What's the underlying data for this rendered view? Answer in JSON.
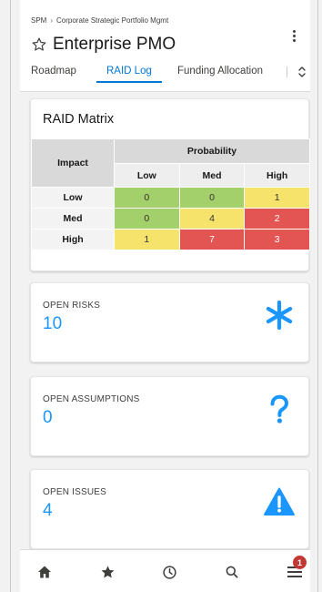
{
  "header": {
    "breadcrumb": [
      "SPM",
      "Corporate Strategic Portfolio Mgmt"
    ],
    "breadcrumb_separator": "›",
    "title": "Enterprise PMO",
    "favorite_icon": "star-outline-icon",
    "more_icon": "kebab-menu-icon"
  },
  "tabs": [
    {
      "label": "Roadmap",
      "active": false
    },
    {
      "label": "RAID Log",
      "active": true
    },
    {
      "label": "Funding Allocation",
      "active": false
    }
  ],
  "matrix": {
    "title": "RAID Matrix",
    "corner_header": "Impact",
    "group_header": "Probability",
    "columns": [
      "Low",
      "Med",
      "High"
    ],
    "rows": [
      {
        "label": "Low",
        "cells": [
          {
            "value": "0",
            "level": "green"
          },
          {
            "value": "0",
            "level": "green"
          },
          {
            "value": "1",
            "level": "yellow"
          }
        ]
      },
      {
        "label": "Med",
        "cells": [
          {
            "value": "0",
            "level": "green"
          },
          {
            "value": "4",
            "level": "yellow"
          },
          {
            "value": "2",
            "level": "red"
          }
        ]
      },
      {
        "label": "High",
        "cells": [
          {
            "value": "1",
            "level": "yellow"
          },
          {
            "value": "7",
            "level": "red"
          },
          {
            "value": "3",
            "level": "red"
          }
        ]
      }
    ],
    "colors": {
      "green": "#a4d06c",
      "yellow": "#f5e36b",
      "red": "#e35553"
    }
  },
  "stats": [
    {
      "label": "OPEN RISKS",
      "value": "10",
      "icon": "asterisk-icon",
      "icon_color": "#1b96ff"
    },
    {
      "label": "OPEN ASSUMPTIONS",
      "value": "0",
      "icon": "question-mark-icon",
      "icon_color": "#1b96ff"
    },
    {
      "label": "OPEN ISSUES",
      "value": "4",
      "icon": "warning-triangle-icon",
      "icon_color": "#1b96ff"
    }
  ],
  "navbar": {
    "items": [
      "home-icon",
      "favorites-star-icon",
      "recent-clock-icon",
      "search-icon",
      "menu-icon"
    ],
    "notification_badge": "1",
    "badge_color": "#c23934"
  },
  "accent_color": "#0176d3"
}
